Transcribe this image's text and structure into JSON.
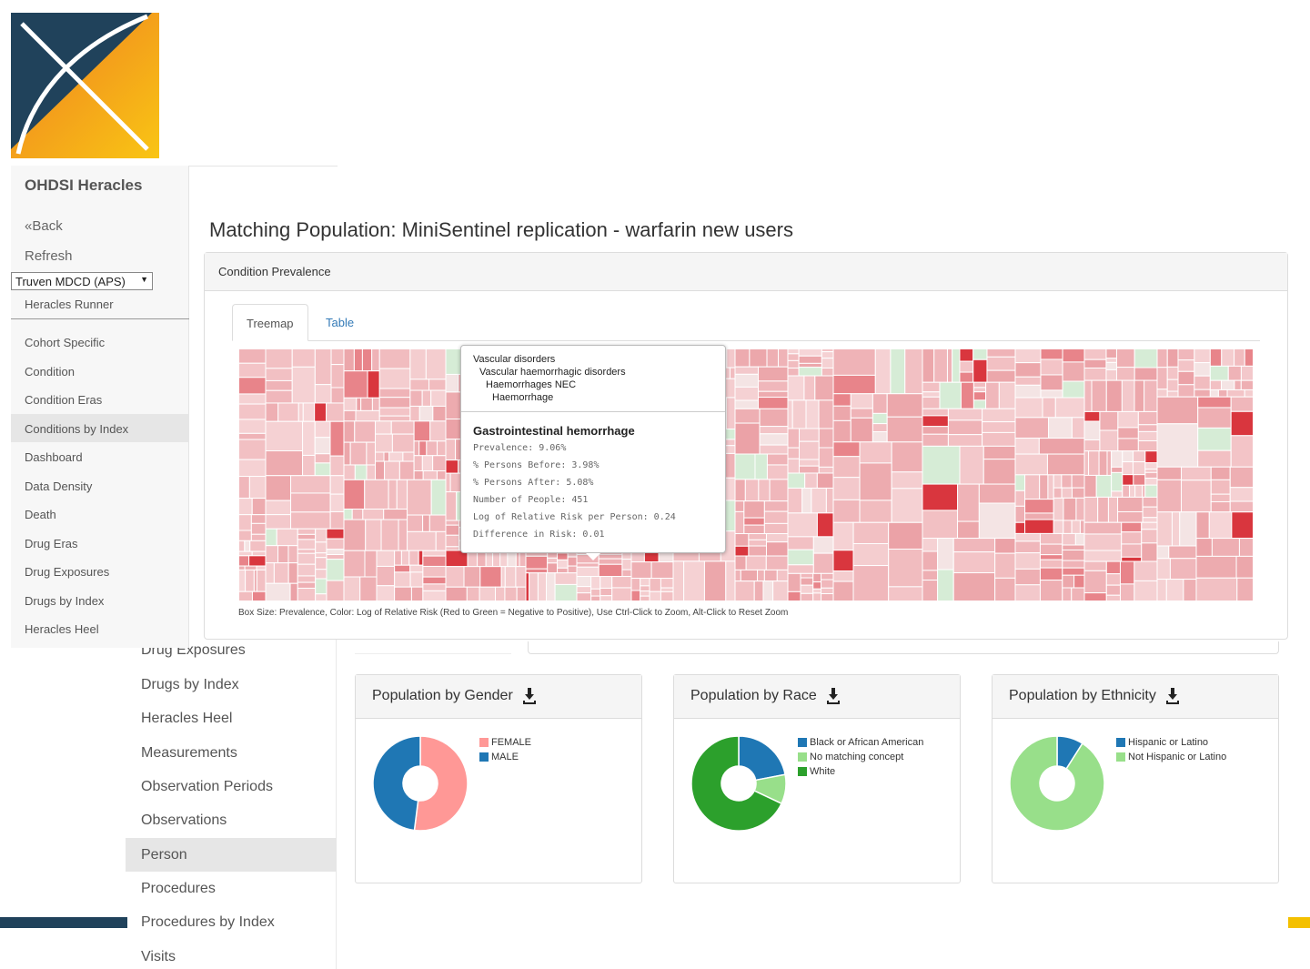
{
  "background_app": {
    "nav": [
      "Drug Exposures",
      "Drugs by Index",
      "Heracles Heel",
      "Measurements",
      "Observation Periods",
      "Observations",
      "Person",
      "Procedures",
      "Procedures by Index",
      "Visits"
    ],
    "active_nav": "Person",
    "cards": [
      {
        "title": "Population by Gender",
        "legend": [
          {
            "label": "FEMALE",
            "color": "#ff9896"
          },
          {
            "label": "MALE",
            "color": "#1f77b4"
          }
        ],
        "values": [
          0.52,
          0.48
        ]
      },
      {
        "title": "Population by Race",
        "legend": [
          {
            "label": "Black or African American",
            "color": "#1f77b4"
          },
          {
            "label": "No matching concept",
            "color": "#98df8a"
          },
          {
            "label": "White",
            "color": "#2ca02c"
          }
        ],
        "values": [
          0.22,
          0.1,
          0.68
        ]
      },
      {
        "title": "Population by Ethnicity",
        "legend": [
          {
            "label": "Hispanic or Latino",
            "color": "#1f77b4"
          },
          {
            "label": "Not Hispanic or Latino",
            "color": "#98df8a"
          }
        ],
        "values": [
          0.09,
          0.91
        ]
      }
    ]
  },
  "sidebar": {
    "brand": "OHDSI Heracles",
    "back": "«Back",
    "refresh": "Refresh",
    "source": "Truven MDCD (APS)",
    "runner": "Heracles Runner",
    "items": [
      "Cohort Specific",
      "Condition",
      "Condition Eras",
      "Conditions by Index",
      "Dashboard",
      "Data Density",
      "Death",
      "Drug Eras",
      "Drug Exposures",
      "Drugs by Index",
      "Heracles Heel"
    ],
    "active_item": "Conditions by Index"
  },
  "main": {
    "title": "Matching Population: MiniSentinel replication - warfarin new users",
    "panel_title": "Condition Prevalence",
    "tabs": [
      "Treemap",
      "Table"
    ],
    "caption": "Box Size: Prevalence, Color: Log of Relative Risk (Red to Green = Negative to Positive), Use Ctrl-Click to Zoom, Alt-Click to Reset Zoom"
  },
  "tooltip": {
    "path": [
      "Vascular disorders",
      "Vascular haemorrhagic disorders",
      "Haemorrhages NEC",
      "Haemorrhage"
    ],
    "name": "Gastrointestinal hemorrhage",
    "stats": [
      "Prevalence: 9.06%",
      "% Persons Before: 3.98%",
      "% Persons After: 5.08%",
      "Number of People: 451",
      "Log of Relative Risk per Person: 0.24",
      "Difference in Risk: 0.01"
    ]
  },
  "colors": {
    "logo_navy": "#20425b",
    "logo_orange": "#f08a24",
    "logo_yellow": "#f9c013",
    "link_blue": "#337ab7",
    "treemap_red": "#e8848a",
    "treemap_green": "#d4ecd4"
  }
}
